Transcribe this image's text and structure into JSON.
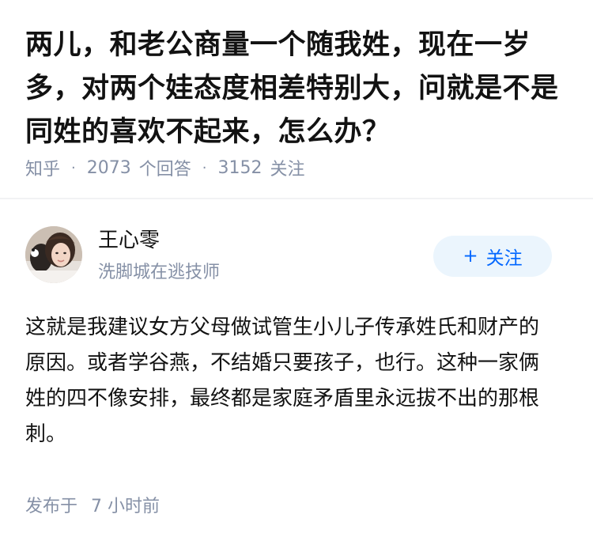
{
  "question": {
    "title": "两儿，和老公商量一个随我姓，现在一岁多，对两个娃态度相差特别大，问就是不是同姓的喜欢不起来，怎么办？",
    "source": "知乎",
    "answer_count": "2073",
    "answer_unit": "个回答",
    "follow_count": "3152",
    "follow_unit": "关注"
  },
  "answer": {
    "author_name": "王心零",
    "author_bio": "洗脚城在逃技师",
    "follow_button": {
      "icon": "plus-icon",
      "label": "关注",
      "plus": "+"
    },
    "content": "这就是我建议女方父母做试管生小儿子传承姓氏和财产的原因。或者学谷燕，不结婚只要孩子，也行。这种一家俩姓的四不像安排，最终都是家庭矛盾里永远拔不出的那根刺。",
    "time_label": "发布于",
    "time_value": "7 小时前"
  },
  "colors": {
    "title": "#121212",
    "meta": "#8590a6",
    "accent": "#0066ff",
    "follow_bg": "#ebf5fd"
  }
}
